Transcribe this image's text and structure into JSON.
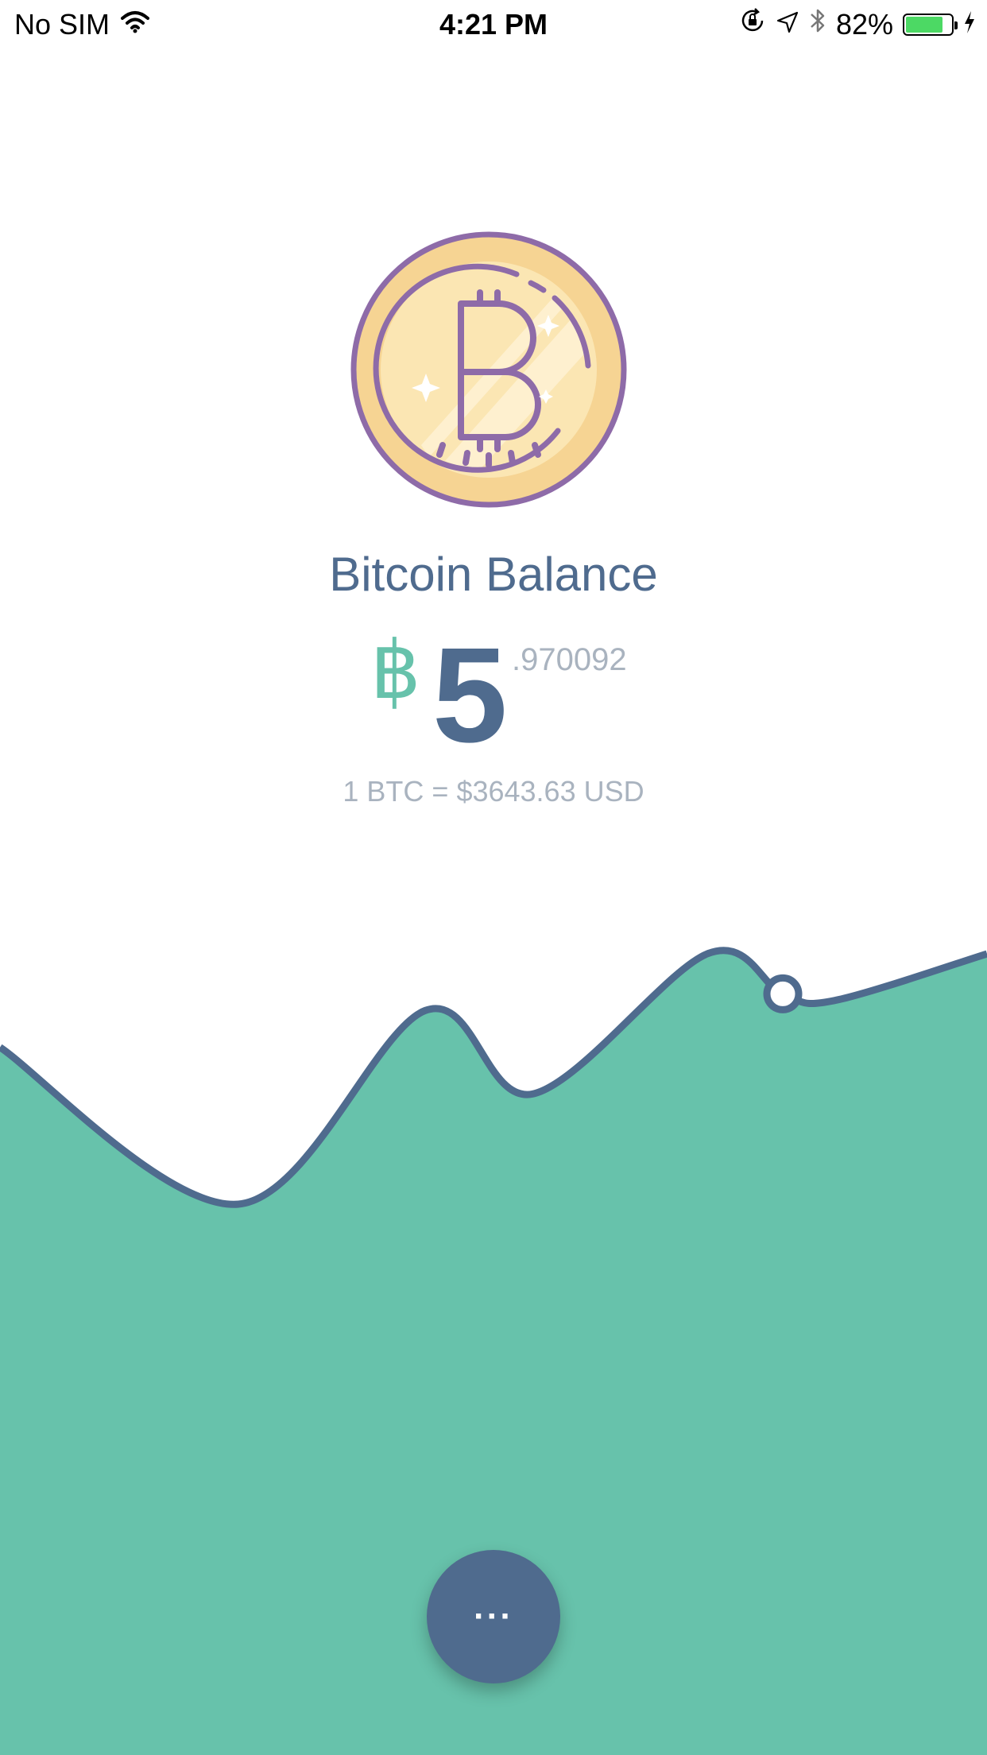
{
  "status_bar": {
    "carrier": "No SIM",
    "time": "4:21 PM",
    "battery_percent": "82%",
    "battery_level": 0.82,
    "icons": [
      "wifi-icon",
      "rotation-lock-icon",
      "location-icon",
      "bluetooth-icon",
      "battery-icon",
      "charging-icon"
    ]
  },
  "header": {
    "coin_icon": "bitcoin-coin-icon",
    "title": "Bitcoin Balance"
  },
  "balance": {
    "currency_symbol": "฿",
    "integer_part": "5",
    "decimal_part": ".970092",
    "rate": "1 BTC = $3643.63 USD"
  },
  "chart": {
    "icon": "price-chart",
    "fill_color": "#67c2ab",
    "line_color": "#4f6b8e",
    "selected_point_index": 5,
    "relative_values": [
      0.72,
      0.25,
      0.83,
      0.58,
      1.0,
      0.88,
      0.86,
      1.0
    ]
  },
  "fab": {
    "label": "···",
    "icon": "more-icon"
  },
  "colors": {
    "accent": "#67c2ab",
    "primary": "#4f6b8e",
    "muted": "#a9b3bf"
  }
}
